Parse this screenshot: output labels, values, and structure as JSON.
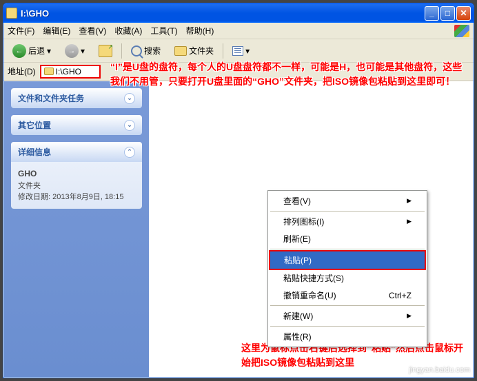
{
  "title": "I:\\GHO",
  "menu": {
    "file": "文件(F)",
    "edit": "编辑(E)",
    "view": "查看(V)",
    "fav": "收藏(A)",
    "tools": "工具(T)",
    "help": "帮助(H)"
  },
  "toolbar": {
    "back": "后退",
    "search": "搜索",
    "folders": "文件夹"
  },
  "address": {
    "label": "地址(D)",
    "path": "I:\\GHO"
  },
  "sidebar": {
    "tasks": "文件和文件夹任务",
    "other": "其它位置",
    "details_title": "详细信息",
    "details_name": "GHO",
    "details_type": "文件夹",
    "details_mod": "修改日期: 2013年8月9日, 18:15"
  },
  "context": {
    "view": "查看(V)",
    "arrange": "排列图标(I)",
    "refresh": "刷新(E)",
    "paste": "粘贴(P)",
    "paste_shortcut": "粘贴快捷方式(S)",
    "undo": "撤销重命名(U)",
    "undo_key": "Ctrl+Z",
    "new": "新建(W)",
    "properties": "属性(R)"
  },
  "annot1": "“I”是U盘的盘符，每个人的U盘盘符都不一样，可能是H，也可能是其他盘符，这些我们不用管，只要打开U盘里面的“GHO”文件夹，把ISO镜像包粘贴到这里即可！",
  "annot2": "这里为鼠标点击右键后选择到“粘贴”然后点击鼠标开始把ISO镜像包粘贴到这里",
  "watermark": "jingyan.baidu.com"
}
